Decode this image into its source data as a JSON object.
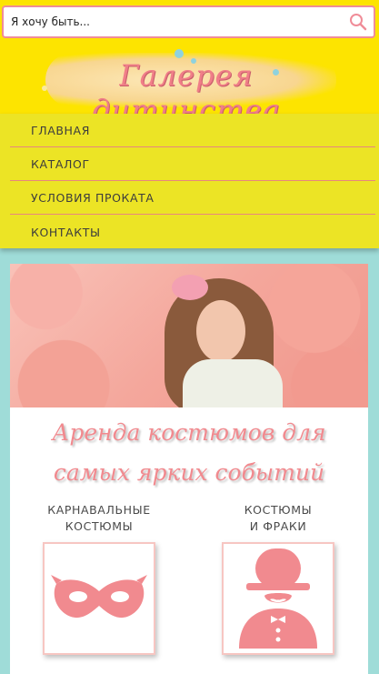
{
  "search": {
    "placeholder": "Я хочу быть..."
  },
  "logo": {
    "text": "Галерея дитинства"
  },
  "nav": {
    "items": [
      {
        "label": "ГЛАВНАЯ"
      },
      {
        "label": "КАТАЛОГ"
      },
      {
        "label": "УСЛОВИЯ ПРОКАТА"
      },
      {
        "label": "КОНТАКТЫ"
      }
    ]
  },
  "main": {
    "title_line1": "Аренда костюмов для",
    "title_line2": "самых ярких событий",
    "categories": [
      {
        "line1": "КАРНАВАЛЬНЫЕ",
        "line2": "КОСТЮМЫ",
        "icon": "carnival-mask-icon"
      },
      {
        "line1": "КОСТЮМЫ",
        "line2": "И ФРАКИ",
        "icon": "gentleman-icon"
      }
    ]
  },
  "colors": {
    "header_bg": "#fde400",
    "nav_bg": "#ece425",
    "accent_pink": "#f18a8f",
    "page_bg": "#9fdcd8"
  }
}
